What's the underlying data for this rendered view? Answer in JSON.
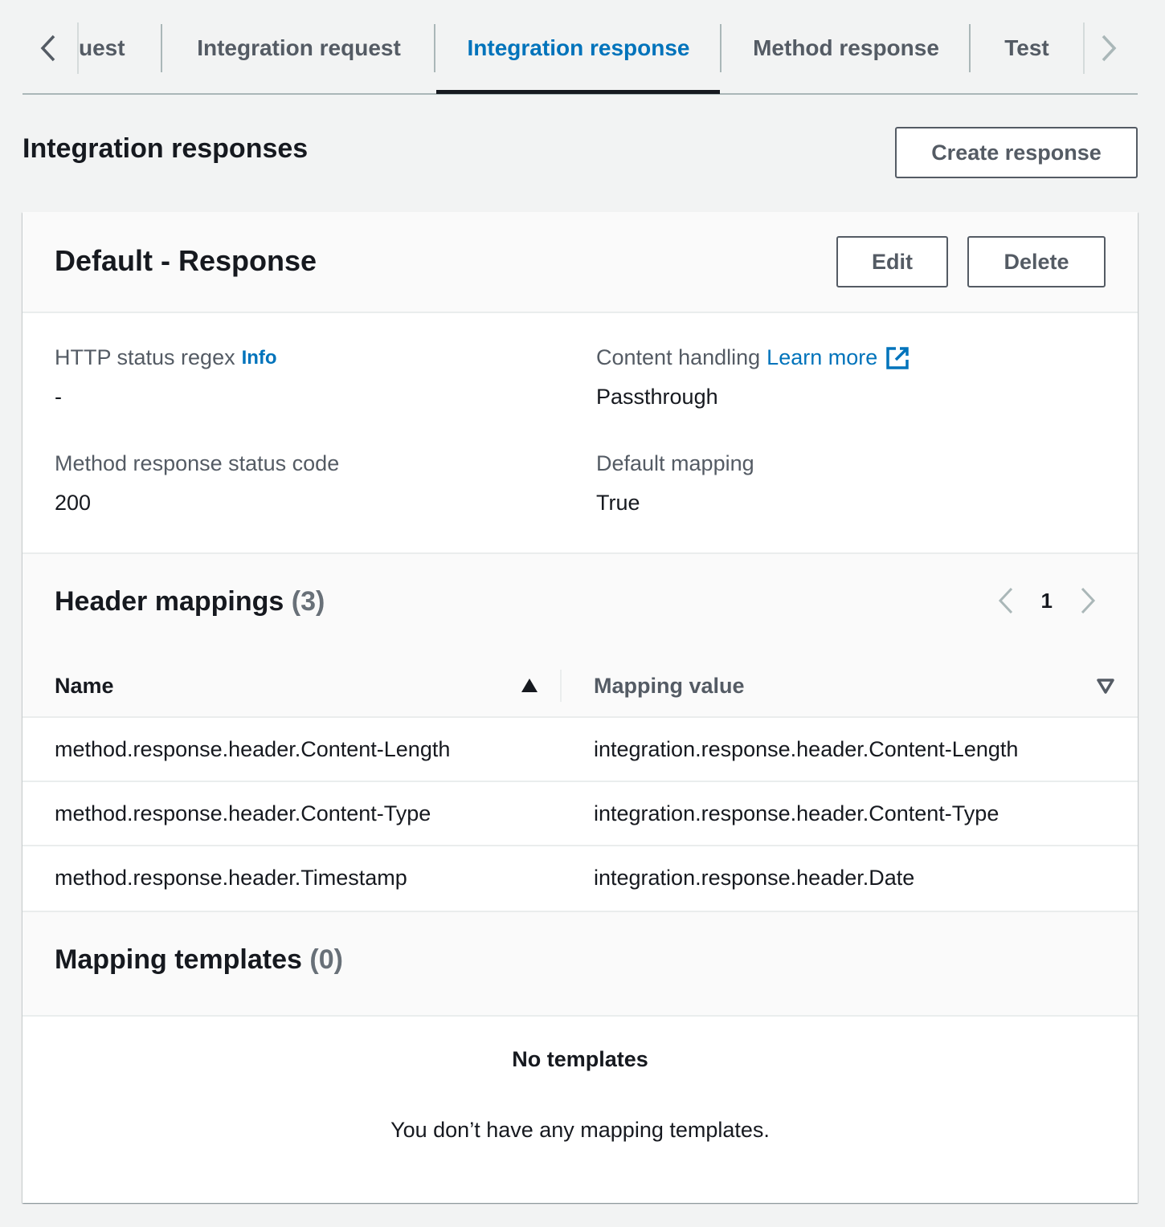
{
  "tabs": {
    "items": [
      {
        "label": "uest",
        "active": false
      },
      {
        "label": "Integration request",
        "active": false
      },
      {
        "label": "Integration response",
        "active": true
      },
      {
        "label": "Method response",
        "active": false
      },
      {
        "label": "Test",
        "active": false
      }
    ],
    "scroll_left_icon": "chevron-left-icon",
    "scroll_right_icon": "chevron-right-icon"
  },
  "section": {
    "title": "Integration responses",
    "create_button": "Create response"
  },
  "response_card": {
    "title": "Default - Response",
    "edit_button": "Edit",
    "delete_button": "Delete",
    "details": {
      "http_status_regex": {
        "label": "HTTP status regex",
        "info_link": "Info",
        "value": "-"
      },
      "content_handling": {
        "label": "Content handling",
        "learn_more_link": "Learn more",
        "value": "Passthrough"
      },
      "method_response_status_code": {
        "label": "Method response status code",
        "value": "200"
      },
      "default_mapping": {
        "label": "Default mapping",
        "value": "True"
      }
    },
    "header_mappings": {
      "title": "Header mappings",
      "count": "(3)",
      "page": "1",
      "columns": [
        "Name",
        "Mapping value"
      ],
      "rows": [
        {
          "name": "method.response.header.Content-Length",
          "value": "integration.response.header.Content-Length"
        },
        {
          "name": "method.response.header.Content-Type",
          "value": "integration.response.header.Content-Type"
        },
        {
          "name": "method.response.header.Timestamp",
          "value": "integration.response.header.Date"
        }
      ]
    },
    "mapping_templates": {
      "title": "Mapping templates",
      "count": "(0)",
      "empty_title": "No templates",
      "empty_description": "You don’t have any mapping templates."
    }
  },
  "colors": {
    "accent": "#0073bb",
    "text": "#16191f",
    "secondary_text": "#545b64",
    "background": "#f2f3f3",
    "border": "#eaeded"
  }
}
